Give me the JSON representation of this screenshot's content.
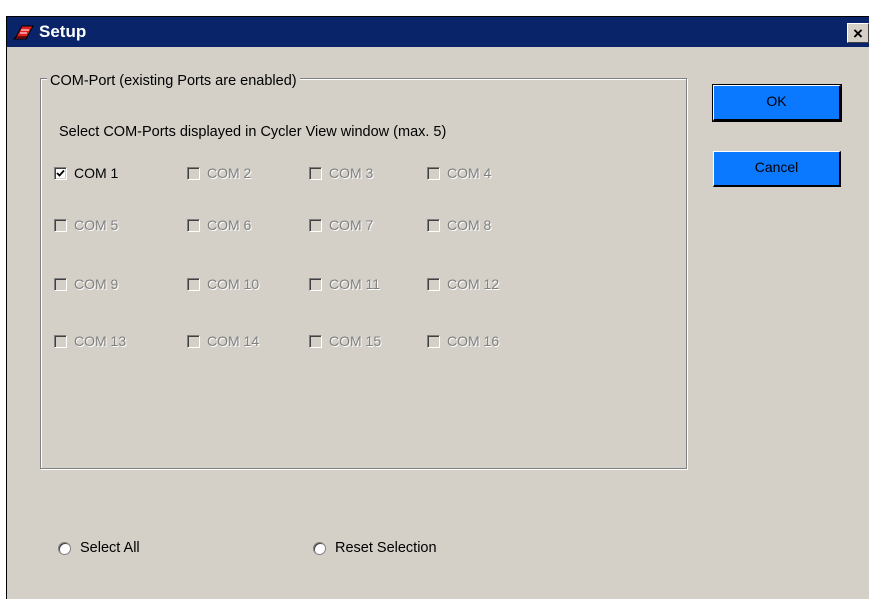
{
  "window": {
    "title": "Setup",
    "close_glyph": "×",
    "app_icon": "red-app-icon",
    "colors": {
      "titlebar": "#0a246a",
      "face": "#d4d0c8",
      "button": "#0a78ff"
    }
  },
  "group": {
    "legend": "COM-Port (existing Ports are enabled)",
    "instruction": "Select COM-Ports displayed in Cycler View window (max. 5)",
    "ports": [
      {
        "label": "COM 1",
        "checked": true,
        "enabled": true
      },
      {
        "label": "COM 2",
        "checked": false,
        "enabled": false
      },
      {
        "label": "COM 3",
        "checked": false,
        "enabled": false
      },
      {
        "label": "COM 4",
        "checked": false,
        "enabled": false
      },
      {
        "label": "COM 5",
        "checked": false,
        "enabled": false
      },
      {
        "label": "COM 6",
        "checked": false,
        "enabled": false
      },
      {
        "label": "COM 7",
        "checked": false,
        "enabled": false
      },
      {
        "label": "COM 8",
        "checked": false,
        "enabled": false
      },
      {
        "label": "COM 9",
        "checked": false,
        "enabled": false
      },
      {
        "label": "COM 10",
        "checked": false,
        "enabled": false
      },
      {
        "label": "COM 11",
        "checked": false,
        "enabled": false
      },
      {
        "label": "COM 12",
        "checked": false,
        "enabled": false
      },
      {
        "label": "COM 13",
        "checked": false,
        "enabled": false
      },
      {
        "label": "COM 14",
        "checked": false,
        "enabled": false
      },
      {
        "label": "COM 15",
        "checked": false,
        "enabled": false
      },
      {
        "label": "COM 16",
        "checked": false,
        "enabled": false
      }
    ]
  },
  "buttons": {
    "ok": "OK",
    "cancel": "Cancel"
  },
  "options": {
    "select_all": "Select All",
    "reset_selection": "Reset Selection"
  }
}
